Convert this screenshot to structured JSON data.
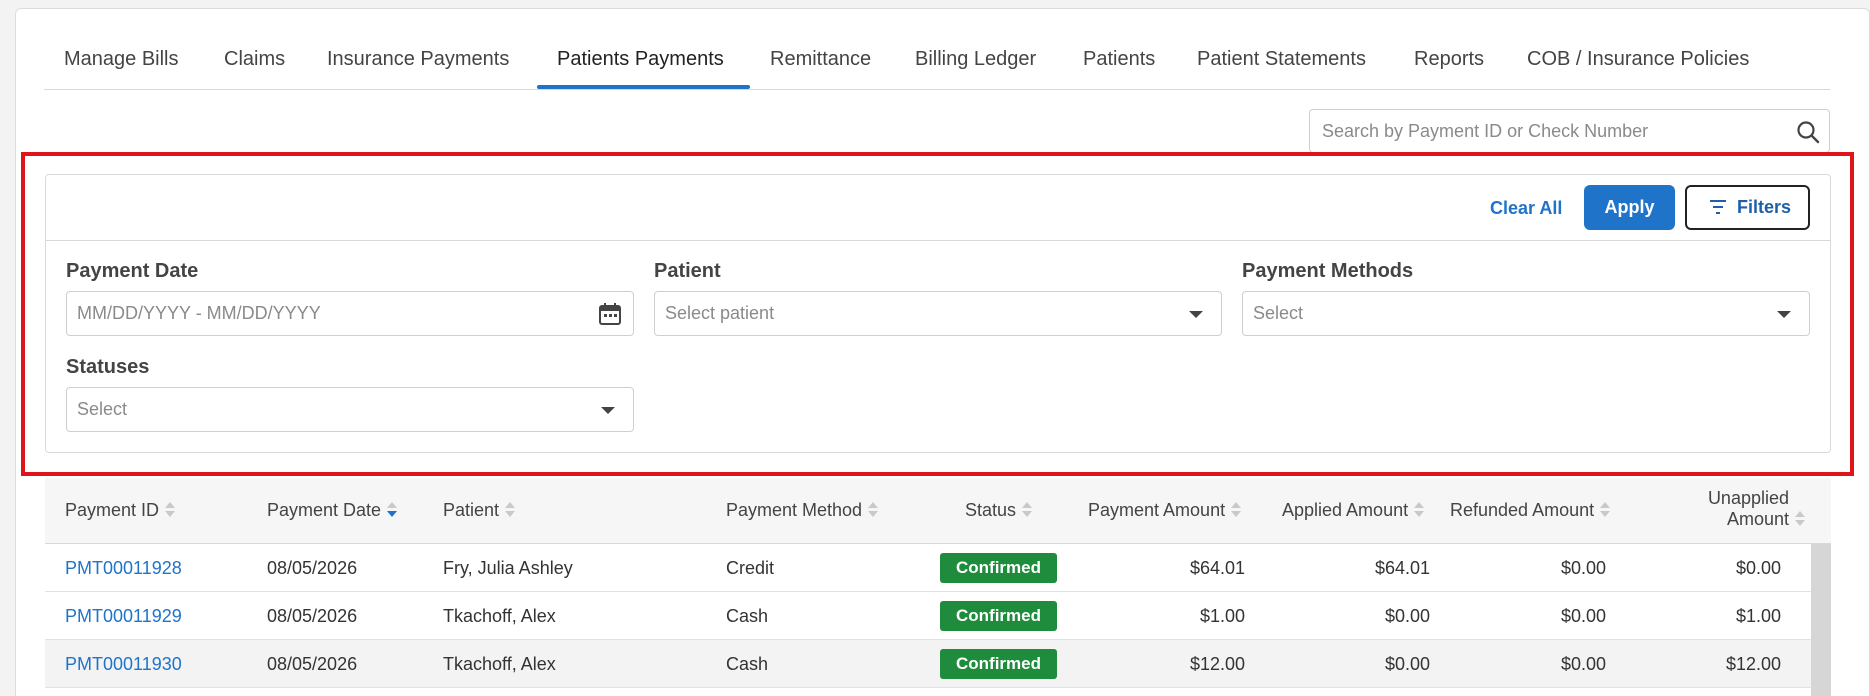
{
  "tabs": [
    {
      "label": "Manage Bills"
    },
    {
      "label": "Claims"
    },
    {
      "label": "Insurance Payments"
    },
    {
      "label": "Patients Payments"
    },
    {
      "label": "Remittance"
    },
    {
      "label": "Billing Ledger"
    },
    {
      "label": "Patients"
    },
    {
      "label": "Patient Statements"
    },
    {
      "label": "Reports"
    },
    {
      "label": "COB / Insurance Policies"
    }
  ],
  "active_tab": "Patients Payments",
  "search": {
    "placeholder": "Search by Payment ID or Check Number",
    "icon": "search-icon"
  },
  "filters": {
    "clear_all": "Clear All",
    "apply": "Apply",
    "filters_label": "Filters",
    "payment_date": {
      "label": "Payment Date",
      "placeholder": "MM/DD/YYYY - MM/DD/YYYY"
    },
    "patient": {
      "label": "Patient",
      "placeholder": "Select patient"
    },
    "payment_methods": {
      "label": "Payment Methods",
      "placeholder": "Select"
    },
    "statuses": {
      "label": "Statuses",
      "placeholder": "Select"
    }
  },
  "table": {
    "headers": {
      "payment_id": "Payment ID",
      "payment_date": "Payment Date",
      "patient": "Patient",
      "payment_method": "Payment Method",
      "status": "Status",
      "payment_amount": "Payment Amount",
      "applied_amount": "Applied Amount",
      "refunded_amount": "Refunded Amount",
      "unapplied_amount_line1": "Unapplied",
      "unapplied_amount_line2": "Amount"
    },
    "rows": [
      {
        "payment_id": "PMT00011928",
        "payment_date": "08/05/2026",
        "patient": "Fry, Julia Ashley",
        "payment_method": "Credit",
        "status": "Confirmed",
        "payment_amount": "$64.01",
        "applied_amount": "$64.01",
        "refunded_amount": "$0.00",
        "unapplied_amount": "$0.00"
      },
      {
        "payment_id": "PMT00011929",
        "payment_date": "08/05/2026",
        "patient": "Tkachoff, Alex",
        "payment_method": "Cash",
        "status": "Confirmed",
        "payment_amount": "$1.00",
        "applied_amount": "$0.00",
        "refunded_amount": "$0.00",
        "unapplied_amount": "$1.00"
      },
      {
        "payment_id": "PMT00011930",
        "payment_date": "08/05/2026",
        "patient": "Tkachoff, Alex",
        "payment_method": "Cash",
        "status": "Confirmed",
        "payment_amount": "$12.00",
        "applied_amount": "$0.00",
        "refunded_amount": "$0.00",
        "unapplied_amount": "$12.00"
      }
    ]
  },
  "colors": {
    "accent": "#1f73c9",
    "highlight": "#e0141b",
    "status_confirmed": "#1e8b3d"
  }
}
